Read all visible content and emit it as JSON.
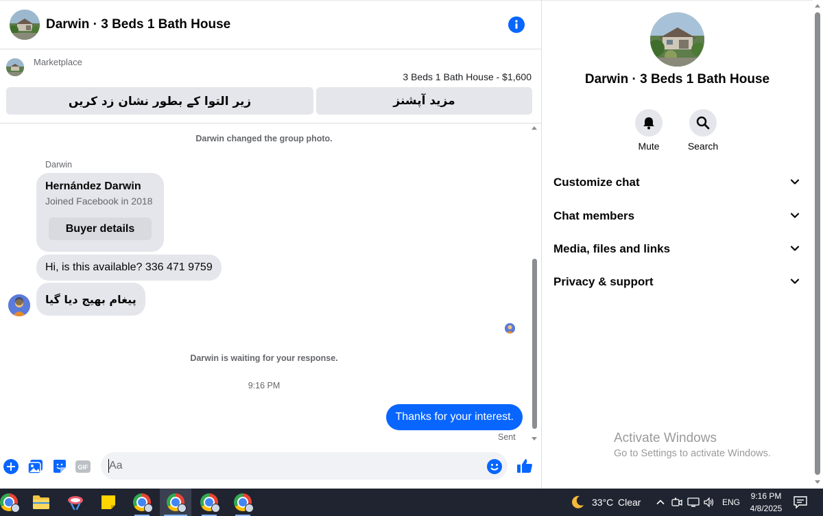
{
  "header": {
    "title": "Darwin · 3 Beds 1 Bath House"
  },
  "marketplace": {
    "label": "Marketplace",
    "listing_title": "3 Beds 1 Bath House - $1,600",
    "mark_pending_label": "زیر التوا کے بطور نشان زد کریں",
    "more_options_label": "مزید آپشنز"
  },
  "messages": {
    "system_photo_changed": "Darwin changed the group photo.",
    "sender_name": "Darwin",
    "buyer_card": {
      "name": "Hernández Darwin",
      "joined": "Joined Facebook in 2018",
      "details_button": "Buyer details"
    },
    "incoming_1": "Hi, is this available? 336 471 9759",
    "incoming_2": "پیغام بھیج دیا گیا",
    "system_waiting": "Darwin is waiting for your response.",
    "timestamp": "9:16 PM",
    "outgoing_1": "Thanks for your interest.",
    "sent_status": "Sent"
  },
  "composer": {
    "placeholder": "Aa"
  },
  "details": {
    "title": "Darwin · 3 Beds 1 Bath House",
    "actions": {
      "mute": "Mute",
      "search": "Search"
    },
    "sections": [
      "Customize chat",
      "Chat members",
      "Media, files and links",
      "Privacy & support"
    ]
  },
  "watermark": {
    "title": "Activate Windows",
    "subtitle": "Go to Settings to activate Windows."
  },
  "taskbar": {
    "weather_temp": "33°C",
    "weather_condition": "Clear",
    "language": "ENG",
    "time": "9:16 PM",
    "date": "4/8/2025"
  },
  "colors": {
    "accent": "#0866ff",
    "bubble_in": "#e4e6eb",
    "taskbar": "#1f2430"
  }
}
